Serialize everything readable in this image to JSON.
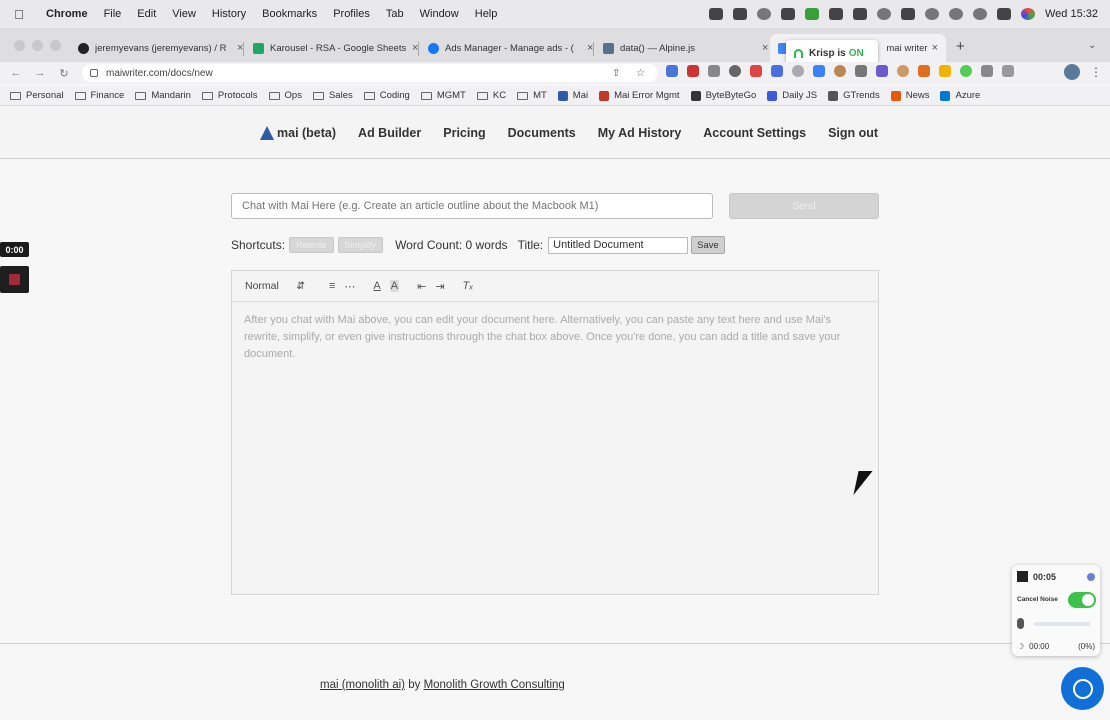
{
  "menubar": {
    "app": "Chrome",
    "items": [
      "File",
      "Edit",
      "View",
      "History",
      "Bookmarks",
      "Profiles",
      "Tab",
      "Window",
      "Help"
    ],
    "clock": "Wed 15:32"
  },
  "browser": {
    "tabs": [
      {
        "title": "jeremyevans (jeremyevans) / R",
        "color": "#222222"
      },
      {
        "title": "Karousel - RSA - Google Sheets",
        "color": "#23a566"
      },
      {
        "title": "Ads Manager - Manage ads - (",
        "color": "#1877f2"
      },
      {
        "title": "data() — Alpine.js",
        "color": "#5a6f8a"
      },
      {
        "title": "mai writer",
        "color": "#4285f4"
      }
    ],
    "krisp_popup": {
      "label": "Krisp is",
      "state": "ON"
    },
    "url": "maiwriter.com/docs/new",
    "bookmarks": [
      {
        "label": "Personal",
        "type": "folder"
      },
      {
        "label": "Finance",
        "type": "folder"
      },
      {
        "label": "Mandarin",
        "type": "folder"
      },
      {
        "label": "Protocols",
        "type": "folder"
      },
      {
        "label": "Ops",
        "type": "folder"
      },
      {
        "label": "Sales",
        "type": "folder"
      },
      {
        "label": "Coding",
        "type": "folder"
      },
      {
        "label": "MGMT",
        "type": "folder"
      },
      {
        "label": "KC",
        "type": "folder"
      },
      {
        "label": "MT",
        "type": "folder"
      },
      {
        "label": "Mai",
        "type": "site",
        "color": "#2f5aa8"
      },
      {
        "label": "Mai Error Mgmt",
        "type": "site",
        "color": "#c0392b"
      },
      {
        "label": "ByteByteGo",
        "type": "site",
        "color": "#333333"
      },
      {
        "label": "Daily JS",
        "type": "site",
        "color": "#3b5bdb"
      },
      {
        "label": "GTrends",
        "type": "site",
        "color": "#555555"
      },
      {
        "label": "News",
        "type": "site",
        "color": "#e8590c"
      },
      {
        "label": "Azure",
        "type": "site",
        "color": "#0078d4"
      }
    ]
  },
  "site": {
    "nav": {
      "brand": "mai (beta)",
      "links": [
        "Ad Builder",
        "Pricing",
        "Documents",
        "My Ad History",
        "Account Settings",
        "Sign out"
      ]
    },
    "chat": {
      "placeholder": "Chat with Mai Here (e.g. Create an article outline about the Macbook M1)",
      "send_label": "Send"
    },
    "shortcuts": {
      "label": "Shortcuts:",
      "buttons": [
        "Rewrite",
        "Simplify"
      ],
      "word_count": "Word Count: 0 words",
      "title_label": "Title:",
      "title_value": "Untitled Document",
      "save_label": "Save"
    },
    "editor": {
      "format": "Normal",
      "placeholder": "After you chat with Mai above, you can edit your document here. Alternatively, you can paste any text here and use Mai's rewrite, simplify, or even give instructions through the chat box above. Once you're done, you can add a title and save your document."
    },
    "footer": {
      "link1": "mai (monolith ai)",
      "by": "by",
      "link2": "Monolith Growth Consulting"
    }
  },
  "overlays": {
    "recorder_time": "0:00",
    "krisp": {
      "timer": "00:05",
      "cancel_noise": "Cancel Noise",
      "talk_time": "00:00",
      "talk_pct": "(0%)"
    }
  }
}
